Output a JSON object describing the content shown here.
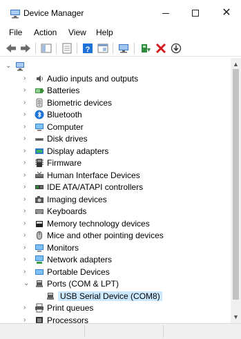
{
  "window": {
    "title": "Device Manager",
    "controls": {
      "minimize": "—",
      "maximize": "☐",
      "close": "✕"
    }
  },
  "menu": [
    "File",
    "Action",
    "View",
    "Help"
  ],
  "toolbar": {
    "icons": [
      "back-arrow-icon",
      "forward-arrow-icon",
      "show-hide-console-tree-icon",
      "properties-icon",
      "help-icon",
      "view-icon",
      "monitor-icon",
      "update-driver-icon",
      "uninstall-device-icon",
      "scan-hardware-icon"
    ]
  },
  "tree": {
    "root_icon": "computer-root-icon",
    "items": [
      {
        "label": "Audio inputs and outputs",
        "icon": "speaker-icon",
        "expanded": false
      },
      {
        "label": "Batteries",
        "icon": "battery-icon",
        "expanded": false
      },
      {
        "label": "Biometric devices",
        "icon": "fingerprint-icon",
        "expanded": false
      },
      {
        "label": "Bluetooth",
        "icon": "bluetooth-icon",
        "expanded": false
      },
      {
        "label": "Computer",
        "icon": "computer-icon",
        "expanded": false
      },
      {
        "label": "Disk drives",
        "icon": "disk-drive-icon",
        "expanded": false
      },
      {
        "label": "Display adapters",
        "icon": "display-adapter-icon",
        "expanded": false
      },
      {
        "label": "Firmware",
        "icon": "firmware-icon",
        "expanded": false
      },
      {
        "label": "Human Interface Devices",
        "icon": "hid-icon",
        "expanded": false
      },
      {
        "label": "IDE ATA/ATAPI controllers",
        "icon": "ide-controller-icon",
        "expanded": false
      },
      {
        "label": "Imaging devices",
        "icon": "camera-icon",
        "expanded": false
      },
      {
        "label": "Keyboards",
        "icon": "keyboard-icon",
        "expanded": false
      },
      {
        "label": "Memory technology devices",
        "icon": "memory-icon",
        "expanded": false
      },
      {
        "label": "Mice and other pointing devices",
        "icon": "mouse-icon",
        "expanded": false
      },
      {
        "label": "Monitors",
        "icon": "monitor-icon",
        "expanded": false
      },
      {
        "label": "Network adapters",
        "icon": "network-adapter-icon",
        "expanded": false
      },
      {
        "label": "Portable Devices",
        "icon": "portable-device-icon",
        "expanded": false
      },
      {
        "label": "Ports (COM & LPT)",
        "icon": "port-icon",
        "expanded": true
      },
      {
        "label": "USB Serial Device (COM8)",
        "icon": "port-icon",
        "child": true,
        "selected": true
      },
      {
        "label": "Print queues",
        "icon": "printer-icon",
        "expanded": false
      },
      {
        "label": "Processors",
        "icon": "processor-icon",
        "expanded": false
      }
    ]
  },
  "colors": {
    "selection": "#cce8ff",
    "accent_green": "#2e8b3d",
    "accent_red": "#d41a1a",
    "accent_blue": "#1e73d8"
  }
}
